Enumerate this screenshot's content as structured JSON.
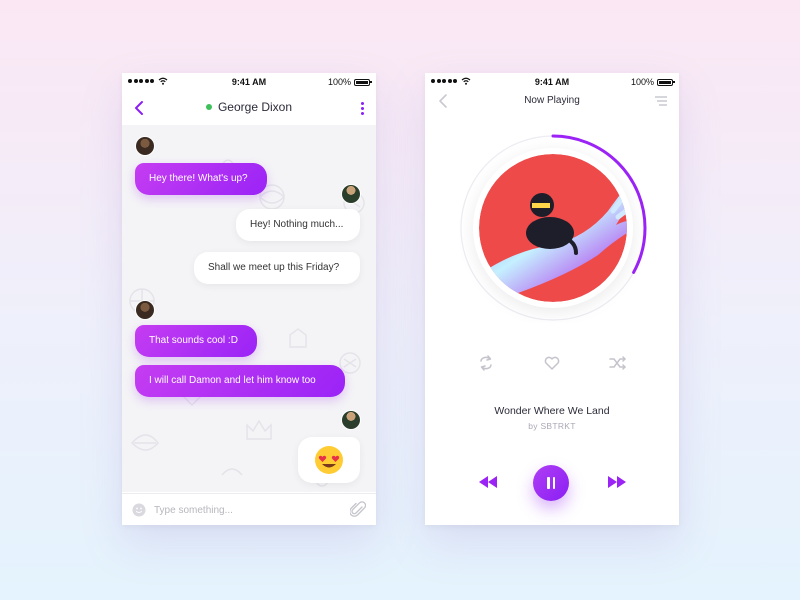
{
  "status_bar": {
    "time": "9:41 AM",
    "battery": "100%"
  },
  "chat": {
    "contact_name": "George Dixon",
    "messages": [
      {
        "from": "them",
        "text": "Hey there! What's up?"
      },
      {
        "from": "me",
        "text": "Hey! Nothing much..."
      },
      {
        "from": "me",
        "text": "Shall we meet up this Friday?"
      },
      {
        "from": "them",
        "text": "That sounds cool :D"
      },
      {
        "from": "them",
        "text": "I will call Damon and let him know too"
      },
      {
        "from": "me",
        "text": "😍"
      }
    ],
    "composer_placeholder": "Type something..."
  },
  "player": {
    "title": "Now Playing",
    "song": "Wonder Where We Land",
    "artist": "by SBTRKT",
    "progress": 0.33
  },
  "colors": {
    "accent": "#9b23f6",
    "online": "#3ec05a",
    "album_bg": "#ee4a4a"
  }
}
